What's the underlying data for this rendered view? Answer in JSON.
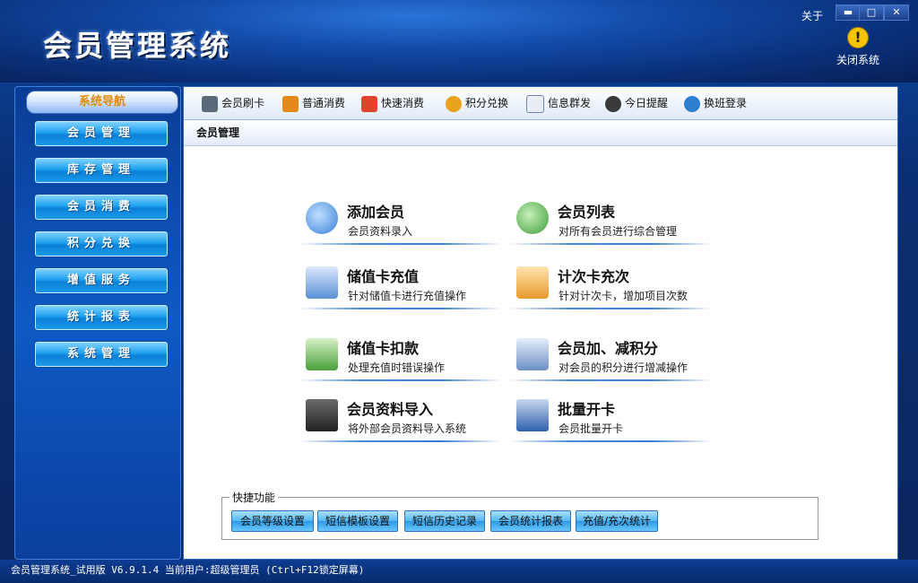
{
  "window": {
    "title": "会员管理系统",
    "about_label": "关于",
    "minimize_glyph": "▬",
    "maximize_glyph": "□",
    "close_glyph": "✕",
    "close_system_label": "关闭系统"
  },
  "nav": {
    "header": "系统导航",
    "items": [
      {
        "label": "会员管理"
      },
      {
        "label": "库存管理"
      },
      {
        "label": "会员消费"
      },
      {
        "label": "积分兑换"
      },
      {
        "label": "增值服务"
      },
      {
        "label": "统计报表"
      },
      {
        "label": "系统管理"
      }
    ]
  },
  "toolbar": {
    "items": [
      {
        "label": "会员刷卡",
        "icon": "card-reader-icon",
        "color": "#5a6a7a"
      },
      {
        "label": "普通消费",
        "icon": "money-bag-icon",
        "color": "#e58a1a"
      },
      {
        "label": "快速消费",
        "icon": "fast-pay-icon",
        "color": "#e0442a"
      },
      {
        "label": "积分兑换",
        "icon": "exchange-icon",
        "color": "#e8a21c"
      },
      {
        "label": "信息群发",
        "icon": "mail-icon",
        "color": "#6c87b0"
      },
      {
        "label": "今日提醒",
        "icon": "clock-icon",
        "color": "#3a3a3a"
      },
      {
        "label": "换班登录",
        "icon": "shift-login-icon",
        "color": "#2f7fd0"
      }
    ]
  },
  "breadcrumb": "会员管理",
  "functions": [
    {
      "title": "添加会员",
      "desc": "会员资料录入",
      "icon": "add-member-icon",
      "color": "#3a7fd8"
    },
    {
      "title": "会员列表",
      "desc": "对所有会员进行综合管理",
      "icon": "member-list-icon",
      "color": "#3b9c3a"
    },
    {
      "title": "储值卡充值",
      "desc": "针对储值卡进行充值操作",
      "icon": "recharge-card-icon",
      "color": "#5a8fd6"
    },
    {
      "title": "计次卡充次",
      "desc": "针对计次卡，增加项目次数",
      "icon": "count-card-icon",
      "color": "#e89a2a"
    },
    {
      "title": "储值卡扣款",
      "desc": "处理充值时错误操作",
      "icon": "deduct-card-icon",
      "color": "#4aa03a"
    },
    {
      "title": "会员加、减积分",
      "desc": "对会员的积分进行增减操作",
      "icon": "points-adjust-icon",
      "color": "#6b8fc4"
    },
    {
      "title": "会员资料导入",
      "desc": "将外部会员资料导入系统",
      "icon": "import-laptop-icon",
      "color": "#333333"
    },
    {
      "title": "批量开卡",
      "desc": "会员批量开卡",
      "icon": "batch-card-icon",
      "color": "#2d5fae"
    }
  ],
  "quick": {
    "legend": "快捷功能",
    "buttons": [
      {
        "label": "会员等级设置"
      },
      {
        "label": "短信模板设置"
      },
      {
        "label": "短信历史记录"
      },
      {
        "label": "会员统计报表"
      },
      {
        "label": "充值/充次统计"
      }
    ]
  },
  "status": "会员管理系统_试用版 V6.9.1.4 当前用户:超级管理员 (Ctrl+F12锁定屏幕)"
}
